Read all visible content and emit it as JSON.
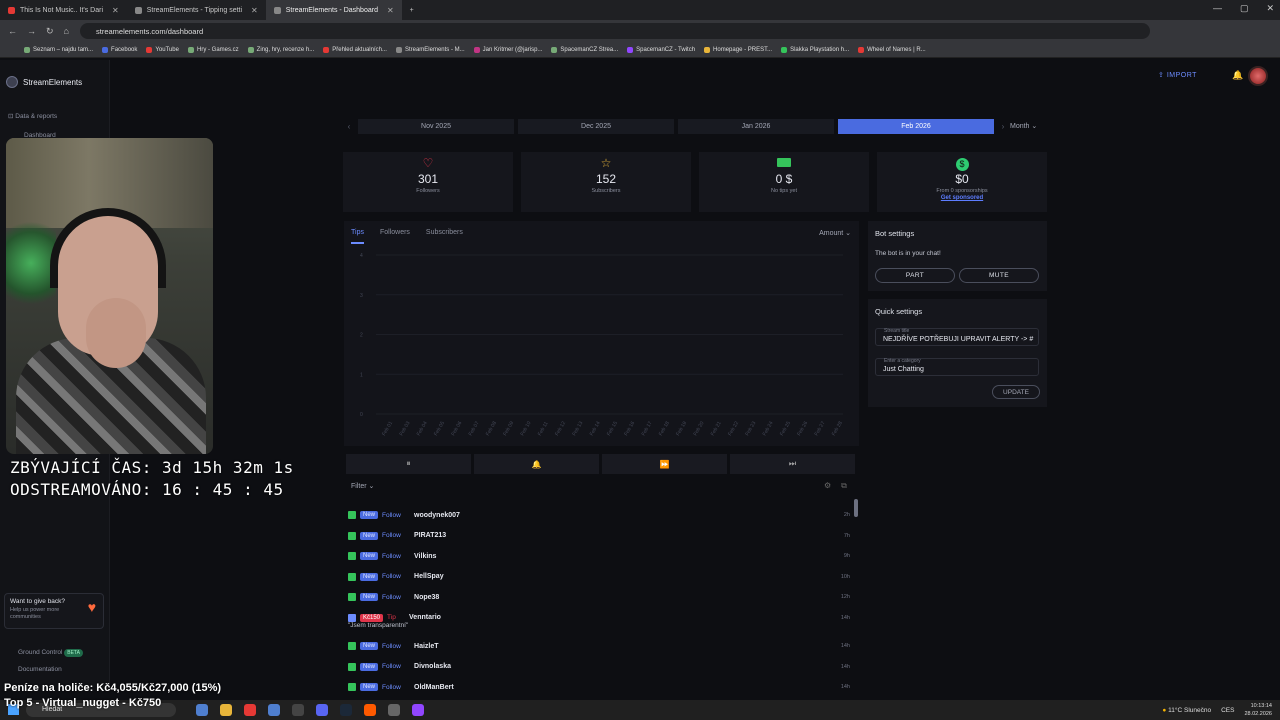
{
  "browser": {
    "tabs": [
      {
        "label": "This Is Not Music.. It's Dari",
        "active": false
      },
      {
        "label": "StreamElements - Tipping setti",
        "active": false
      },
      {
        "label": "StreamElements - Dashboard",
        "active": true
      }
    ],
    "url": "streamelements.com/dashboard",
    "bookmarks": [
      "Seznam – najdu tam...",
      "Facebook",
      "YouTube",
      "Hry - Games.cz",
      "Zing, hry, recenze h...",
      "Přehled aktualních...",
      "StreamElements - M...",
      "Jan Kritmer (@jarisp...",
      "SpacemanCZ Strea...",
      "SpacemanCZ - Twitch",
      "Homepage - PREST...",
      "Slakka Playstation h...",
      "Wheel of Names | R..."
    ]
  },
  "sidebar": {
    "brand": "StreamElements",
    "section": "Data & reports",
    "item": "Dashboard",
    "giveback_title": "Want to give back?",
    "giveback_sub": "Help us power more communities",
    "ground_control": "Ground Control",
    "beta": "BETA",
    "documentation": "Documentation"
  },
  "overlay": {
    "remaining_label": "ZBÝVAJÍCÍ ČAS:",
    "remaining_value": "3d 15h 32m 1s",
    "streamed_label": "ODSTREAMOVÁNO:",
    "streamed_value": "16 : 45 : 45",
    "money": "Peníze na holiče: Kč4,055/Kč27,000 (15%)",
    "top": "Top 5 - Virtual_nugget - Kč750"
  },
  "header": {
    "import_label": "IMPORT"
  },
  "months": [
    "Nov 2025",
    "Dec 2025",
    "Jan 2026",
    "Feb 2026"
  ],
  "selected_month": "Feb 2026",
  "period_select": "Month",
  "stats": [
    {
      "value": "301",
      "label": "Followers",
      "icon": "heart-icon",
      "color": "#e0354a"
    },
    {
      "value": "152",
      "label": "Subscribers",
      "icon": "star-icon",
      "color": "#e8b53a"
    },
    {
      "value": "0 $",
      "label": "No tips yet",
      "icon": "cash-icon",
      "color": "#35c45b"
    },
    {
      "value": "$0",
      "label": "From 0 sponsorships",
      "icon": "dollar-icon",
      "color": "#2ecc71",
      "link": "Get sponsored"
    }
  ],
  "chart_tabs": [
    "Tips",
    "Followers",
    "Subscribers"
  ],
  "chart_metric": "Amount",
  "chart_data": {
    "type": "bar",
    "categories": [
      "Feb 01",
      "Feb 03",
      "Feb 04",
      "Feb 05",
      "Feb 06",
      "Feb 07",
      "Feb 08",
      "Feb 09",
      "Feb 10",
      "Feb 11",
      "Feb 12",
      "Feb 13",
      "Feb 14",
      "Feb 15",
      "Feb 16",
      "Feb 17",
      "Feb 18",
      "Feb 19",
      "Feb 20",
      "Feb 21",
      "Feb 22",
      "Feb 23",
      "Feb 24",
      "Feb 25",
      "Feb 26",
      "Feb 27",
      "Feb 28"
    ],
    "values": [
      0,
      0,
      0,
      0,
      0,
      0,
      0,
      0,
      0,
      0,
      0,
      0,
      0,
      0,
      0,
      0,
      0,
      0,
      0,
      0,
      0,
      0,
      0,
      0,
      0,
      0,
      0
    ],
    "yticks": [
      "0",
      "1",
      "2",
      "3",
      "4"
    ],
    "ylim": [
      0,
      4
    ]
  },
  "feed": {
    "filter_label": "Filter",
    "rows": [
      {
        "type": "follow",
        "badge": "New",
        "kind": "Follow",
        "user": "woodynek007",
        "time": "2h"
      },
      {
        "type": "follow",
        "badge": "New",
        "kind": "Follow",
        "user": "PIRAT213",
        "time": "7h"
      },
      {
        "type": "follow",
        "badge": "New",
        "kind": "Follow",
        "user": "Vilkins",
        "time": "9h"
      },
      {
        "type": "follow",
        "badge": "New",
        "kind": "Follow",
        "user": "HellSpay",
        "time": "10h"
      },
      {
        "type": "follow",
        "badge": "New",
        "kind": "Follow",
        "user": "Nope38",
        "time": "12h"
      },
      {
        "type": "tip",
        "badge": "Kč150",
        "kind": "Tip",
        "user": "Venntario",
        "time": "14h",
        "message": "\"Jsem transparentní\""
      },
      {
        "type": "follow",
        "badge": "New",
        "kind": "Follow",
        "user": "HaizleT",
        "time": "14h"
      },
      {
        "type": "follow",
        "badge": "New",
        "kind": "Follow",
        "user": "Divnolaska",
        "time": "14h"
      },
      {
        "type": "follow",
        "badge": "New",
        "kind": "Follow",
        "user": "OldManBert",
        "time": "14h"
      }
    ]
  },
  "bot": {
    "title": "Bot settings",
    "status": "The bot is in your chat!",
    "part": "PART",
    "mute": "MUTE"
  },
  "quick": {
    "title": "Quick settings",
    "stream_title_label": "Stream title",
    "stream_title": "NEJDŘÍVE POTŘEBUJI UPRAVIT ALERTY -> #",
    "category_label": "Enter a category",
    "category": "Just Chatting",
    "update": "UPDATE"
  },
  "taskbar": {
    "search": "Hledat",
    "weather": "11°C Slunečno",
    "lang": "CES",
    "time": "10:13:14",
    "date": "28.02.2026"
  }
}
